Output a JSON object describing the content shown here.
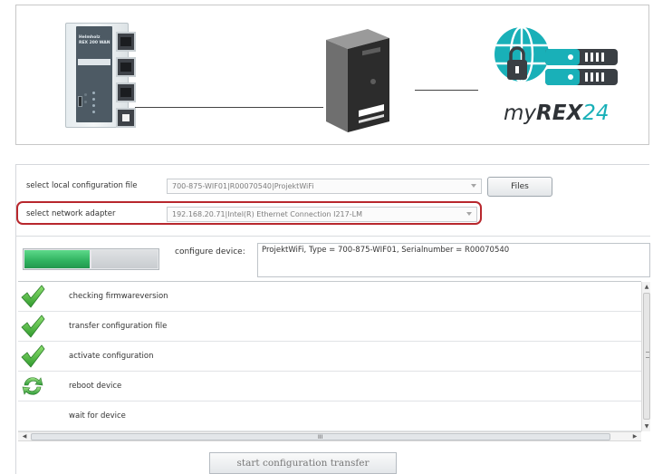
{
  "diagram": {
    "router": {
      "brand_line1": "Helmholz",
      "brand_line2": "REX 200 WAN"
    },
    "cloud_logo": {
      "prefix": "my",
      "rex": "REX",
      "number": "24",
      "accent_color": "#19b0b8"
    }
  },
  "form": {
    "local_file": {
      "label": "select local configuration file",
      "value": "700-875-WIF01|R00070540|ProjektWiFi"
    },
    "files_button": "Files",
    "network_adapter": {
      "label": "select network adapter",
      "value": "192.168.20.71|Intel(R) Ethernet Connection I217-LM",
      "highlight_color": "#b8272d"
    }
  },
  "progress": {
    "fraction": 0.48,
    "configure_label": "configure device:",
    "device_info": "ProjektWiFi, Type = 700-875-WIF01, Serialnumber = R00070540"
  },
  "steps": [
    {
      "label": "checking firmwareversion",
      "status": "done",
      "icon": "checkmark-icon"
    },
    {
      "label": "transfer configuration file",
      "status": "done",
      "icon": "checkmark-icon"
    },
    {
      "label": "activate configuration",
      "status": "done",
      "icon": "checkmark-icon"
    },
    {
      "label": "reboot device",
      "status": "in-progress",
      "icon": "refresh-icon"
    },
    {
      "label": "wait for device",
      "status": "pending",
      "icon": ""
    }
  ],
  "scrollbar": {
    "grip": "III"
  },
  "start_button": "start configuration transfer"
}
